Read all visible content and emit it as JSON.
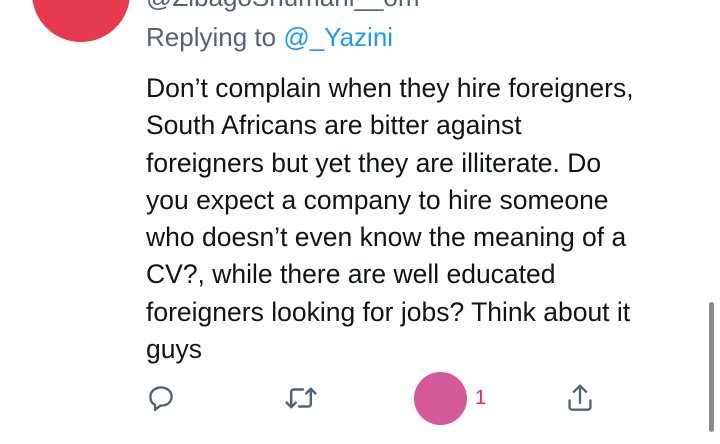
{
  "tweet": {
    "handle": "@ZibagoShumani__om",
    "replying_prefix": "Replying to ",
    "replying_to": "@_Yazini",
    "text_lines": [
      "Don’t complain when they hire foreigners,",
      "South Africans are bitter against",
      "foreigners but yet they are illiterate. Do",
      "you expect a company to hire someone",
      "who doesn’t even know the meaning of a",
      "CV?, while there are well educated",
      "foreigners looking for jobs? Think about it",
      "guys"
    ]
  },
  "actions": {
    "reply_icon": "reply-icon",
    "retweet_icon": "retweet-icon",
    "like_icon": "like-icon",
    "like_count": "1",
    "share_icon": "share-icon"
  },
  "colors": {
    "text": "#0f1419",
    "secondary": "#536471",
    "link": "#1d9bf0",
    "like": "#f91880",
    "like_marker": "#d4589a"
  }
}
